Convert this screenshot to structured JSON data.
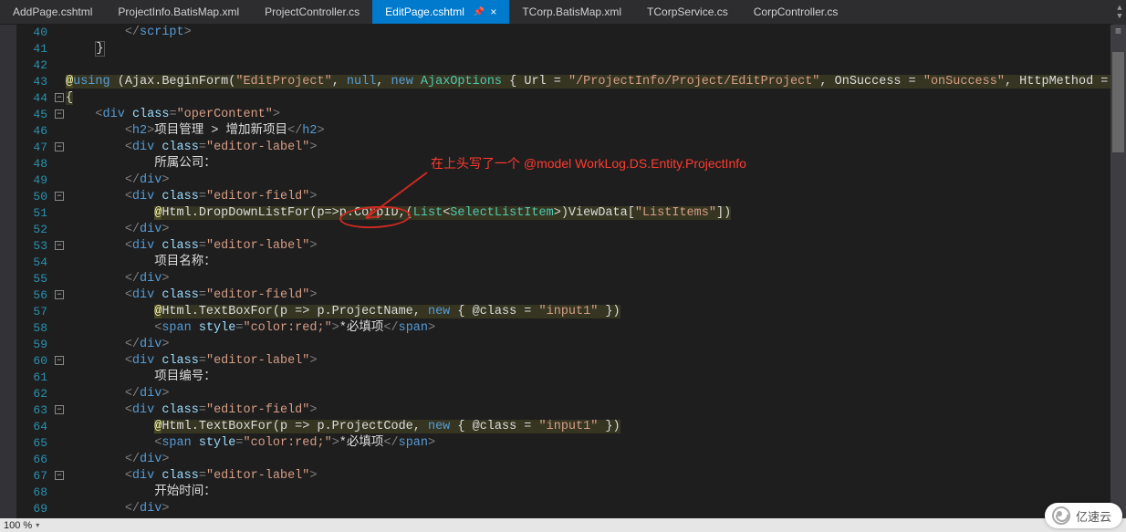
{
  "tabs": [
    {
      "label": "AddPage.cshtml",
      "active": false
    },
    {
      "label": "ProjectInfo.BatisMap.xml",
      "active": false
    },
    {
      "label": "ProjectController.cs",
      "active": false
    },
    {
      "label": "EditPage.cshtml",
      "active": true
    },
    {
      "label": "TCorp.BatisMap.xml",
      "active": false
    },
    {
      "label": "TCorpService.cs",
      "active": false
    },
    {
      "label": "CorpController.cs",
      "active": false
    }
  ],
  "annotation": {
    "text_cn": "在上头写了一个  ",
    "text_model": "@model WorkLog.DS.Entity.ProjectInfo"
  },
  "status": {
    "zoom": "100 %"
  },
  "watermark": "亿速云",
  "line_start": 40,
  "lines": [
    {
      "n": 40,
      "fold": "",
      "tokens": [
        [
          "plain",
          "        "
        ],
        [
          "tagp",
          "</"
        ],
        [
          "tagn",
          "script"
        ],
        [
          "tagp",
          ">"
        ]
      ]
    },
    {
      "n": 41,
      "fold": "",
      "tokens": [
        [
          "plain",
          "    "
        ],
        [
          "plain brace-hl",
          "}"
        ]
      ]
    },
    {
      "n": 42,
      "fold": "",
      "tokens": [
        [
          "plain",
          ""
        ]
      ]
    },
    {
      "n": 43,
      "fold": "",
      "tokens": [
        [
          "razor",
          "@"
        ],
        [
          "kw rzblk",
          "using"
        ],
        [
          "plain rzblk",
          " (Ajax.BeginForm("
        ],
        [
          "str rzblk",
          "\"EditProject\""
        ],
        [
          "plain rzblk",
          ", "
        ],
        [
          "kw rzblk",
          "null"
        ],
        [
          "plain rzblk",
          ", "
        ],
        [
          "kw rzblk",
          "new"
        ],
        [
          "plain rzblk",
          " "
        ],
        [
          "type rzblk",
          "AjaxOptions"
        ],
        [
          "plain rzblk",
          " { Url = "
        ],
        [
          "str rzblk",
          "\"/ProjectInfo/Project/EditProject\""
        ],
        [
          "plain rzblk",
          ", OnSuccess = "
        ],
        [
          "str rzblk",
          "\"onSuccess\""
        ],
        [
          "plain rzblk",
          ", HttpMethod = "
        ]
      ]
    },
    {
      "n": 44,
      "fold": "-",
      "tokens": [
        [
          "plain rzblk",
          "{"
        ]
      ]
    },
    {
      "n": 45,
      "fold": "-",
      "tokens": [
        [
          "plain",
          "    "
        ],
        [
          "tagp",
          "<"
        ],
        [
          "tagn",
          "div"
        ],
        [
          "plain",
          " "
        ],
        [
          "attr",
          "class"
        ],
        [
          "tagp",
          "="
        ],
        [
          "str",
          "\"operContent\""
        ],
        [
          "tagp",
          ">"
        ]
      ]
    },
    {
      "n": 46,
      "fold": "",
      "tokens": [
        [
          "plain",
          "        "
        ],
        [
          "tagp",
          "<"
        ],
        [
          "tagn",
          "h2"
        ],
        [
          "tagp",
          ">"
        ],
        [
          "plain",
          "项目管理 > 增加新项目"
        ],
        [
          "tagp",
          "</"
        ],
        [
          "tagn",
          "h2"
        ],
        [
          "tagp",
          ">"
        ]
      ]
    },
    {
      "n": 47,
      "fold": "-",
      "tokens": [
        [
          "plain",
          "        "
        ],
        [
          "tagp",
          "<"
        ],
        [
          "tagn",
          "div"
        ],
        [
          "plain",
          " "
        ],
        [
          "attr",
          "class"
        ],
        [
          "tagp",
          "="
        ],
        [
          "str",
          "\"editor-label\""
        ],
        [
          "tagp",
          ">"
        ]
      ]
    },
    {
      "n": 48,
      "fold": "",
      "tokens": [
        [
          "plain",
          "            所属公司："
        ]
      ]
    },
    {
      "n": 49,
      "fold": "",
      "tokens": [
        [
          "plain",
          "        "
        ],
        [
          "tagp",
          "</"
        ],
        [
          "tagn",
          "div"
        ],
        [
          "tagp",
          ">"
        ]
      ]
    },
    {
      "n": 50,
      "fold": "-",
      "tokens": [
        [
          "plain",
          "        "
        ],
        [
          "tagp",
          "<"
        ],
        [
          "tagn",
          "div"
        ],
        [
          "plain",
          " "
        ],
        [
          "attr",
          "class"
        ],
        [
          "tagp",
          "="
        ],
        [
          "str",
          "\"editor-field\""
        ],
        [
          "tagp",
          ">"
        ]
      ]
    },
    {
      "n": 51,
      "fold": "",
      "tokens": [
        [
          "plain",
          "            "
        ],
        [
          "razor",
          "@"
        ],
        [
          "plain rzblk",
          "Html.DropDownListFor(p=>p.CorpID,("
        ],
        [
          "type rzblk",
          "List"
        ],
        [
          "plain rzblk",
          "<"
        ],
        [
          "type rzblk",
          "SelectListItem"
        ],
        [
          "plain rzblk",
          ">)ViewData["
        ],
        [
          "str rzblk",
          "\"ListItems\""
        ],
        [
          "plain rzblk",
          "])"
        ]
      ]
    },
    {
      "n": 52,
      "fold": "",
      "tokens": [
        [
          "plain",
          "        "
        ],
        [
          "tagp",
          "</"
        ],
        [
          "tagn",
          "div"
        ],
        [
          "tagp",
          ">"
        ]
      ]
    },
    {
      "n": 53,
      "fold": "-",
      "tokens": [
        [
          "plain",
          "        "
        ],
        [
          "tagp",
          "<"
        ],
        [
          "tagn",
          "div"
        ],
        [
          "plain",
          " "
        ],
        [
          "attr",
          "class"
        ],
        [
          "tagp",
          "="
        ],
        [
          "str",
          "\"editor-label\""
        ],
        [
          "tagp",
          ">"
        ]
      ]
    },
    {
      "n": 54,
      "fold": "",
      "tokens": [
        [
          "plain",
          "            项目名称："
        ]
      ]
    },
    {
      "n": 55,
      "fold": "",
      "tokens": [
        [
          "plain",
          "        "
        ],
        [
          "tagp",
          "</"
        ],
        [
          "tagn",
          "div"
        ],
        [
          "tagp",
          ">"
        ]
      ]
    },
    {
      "n": 56,
      "fold": "-",
      "tokens": [
        [
          "plain",
          "        "
        ],
        [
          "tagp",
          "<"
        ],
        [
          "tagn",
          "div"
        ],
        [
          "plain",
          " "
        ],
        [
          "attr",
          "class"
        ],
        [
          "tagp",
          "="
        ],
        [
          "str",
          "\"editor-field\""
        ],
        [
          "tagp",
          ">"
        ]
      ]
    },
    {
      "n": 57,
      "fold": "",
      "tokens": [
        [
          "plain",
          "            "
        ],
        [
          "razor",
          "@"
        ],
        [
          "plain rzblk",
          "Html.TextBoxFor(p => p.ProjectName, "
        ],
        [
          "kw rzblk",
          "new"
        ],
        [
          "plain rzblk",
          " { @class = "
        ],
        [
          "str rzblk",
          "\"input1\""
        ],
        [
          "plain rzblk",
          " })"
        ]
      ]
    },
    {
      "n": 58,
      "fold": "",
      "tokens": [
        [
          "plain",
          "            "
        ],
        [
          "tagp",
          "<"
        ],
        [
          "tagn",
          "span"
        ],
        [
          "plain",
          " "
        ],
        [
          "attr",
          "style"
        ],
        [
          "tagp",
          "="
        ],
        [
          "str",
          "\"color:red;\""
        ],
        [
          "tagp",
          ">"
        ],
        [
          "plain",
          "*必填项"
        ],
        [
          "tagp",
          "</"
        ],
        [
          "tagn",
          "span"
        ],
        [
          "tagp",
          ">"
        ]
      ]
    },
    {
      "n": 59,
      "fold": "",
      "tokens": [
        [
          "plain",
          "        "
        ],
        [
          "tagp",
          "</"
        ],
        [
          "tagn",
          "div"
        ],
        [
          "tagp",
          ">"
        ]
      ]
    },
    {
      "n": 60,
      "fold": "-",
      "tokens": [
        [
          "plain",
          "        "
        ],
        [
          "tagp",
          "<"
        ],
        [
          "tagn",
          "div"
        ],
        [
          "plain",
          " "
        ],
        [
          "attr",
          "class"
        ],
        [
          "tagp",
          "="
        ],
        [
          "str",
          "\"editor-label\""
        ],
        [
          "tagp",
          ">"
        ]
      ]
    },
    {
      "n": 61,
      "fold": "",
      "tokens": [
        [
          "plain",
          "            项目编号："
        ]
      ]
    },
    {
      "n": 62,
      "fold": "",
      "tokens": [
        [
          "plain",
          "        "
        ],
        [
          "tagp",
          "</"
        ],
        [
          "tagn",
          "div"
        ],
        [
          "tagp",
          ">"
        ]
      ]
    },
    {
      "n": 63,
      "fold": "-",
      "tokens": [
        [
          "plain",
          "        "
        ],
        [
          "tagp",
          "<"
        ],
        [
          "tagn",
          "div"
        ],
        [
          "plain",
          " "
        ],
        [
          "attr",
          "class"
        ],
        [
          "tagp",
          "="
        ],
        [
          "str",
          "\"editor-field\""
        ],
        [
          "tagp",
          ">"
        ]
      ]
    },
    {
      "n": 64,
      "fold": "",
      "tokens": [
        [
          "plain",
          "            "
        ],
        [
          "razor",
          "@"
        ],
        [
          "plain rzblk",
          "Html.TextBoxFor(p => p.ProjectCode, "
        ],
        [
          "kw rzblk",
          "new"
        ],
        [
          "plain rzblk",
          " { @class = "
        ],
        [
          "str rzblk",
          "\"input1\""
        ],
        [
          "plain rzblk",
          " })"
        ]
      ]
    },
    {
      "n": 65,
      "fold": "",
      "tokens": [
        [
          "plain",
          "            "
        ],
        [
          "tagp",
          "<"
        ],
        [
          "tagn",
          "span"
        ],
        [
          "plain",
          " "
        ],
        [
          "attr",
          "style"
        ],
        [
          "tagp",
          "="
        ],
        [
          "str",
          "\"color:red;\""
        ],
        [
          "tagp",
          ">"
        ],
        [
          "plain",
          "*必填项"
        ],
        [
          "tagp",
          "</"
        ],
        [
          "tagn",
          "span"
        ],
        [
          "tagp",
          ">"
        ]
      ]
    },
    {
      "n": 66,
      "fold": "",
      "tokens": [
        [
          "plain",
          "        "
        ],
        [
          "tagp",
          "</"
        ],
        [
          "tagn",
          "div"
        ],
        [
          "tagp",
          ">"
        ]
      ]
    },
    {
      "n": 67,
      "fold": "-",
      "tokens": [
        [
          "plain",
          "        "
        ],
        [
          "tagp",
          "<"
        ],
        [
          "tagn",
          "div"
        ],
        [
          "plain",
          " "
        ],
        [
          "attr",
          "class"
        ],
        [
          "tagp",
          "="
        ],
        [
          "str",
          "\"editor-label\""
        ],
        [
          "tagp",
          ">"
        ]
      ]
    },
    {
      "n": 68,
      "fold": "",
      "tokens": [
        [
          "plain",
          "            开始时间："
        ]
      ]
    },
    {
      "n": 69,
      "fold": "",
      "tokens": [
        [
          "plain",
          "        "
        ],
        [
          "tagp",
          "</"
        ],
        [
          "tagn",
          "div"
        ],
        [
          "tagp",
          ">"
        ]
      ]
    }
  ]
}
